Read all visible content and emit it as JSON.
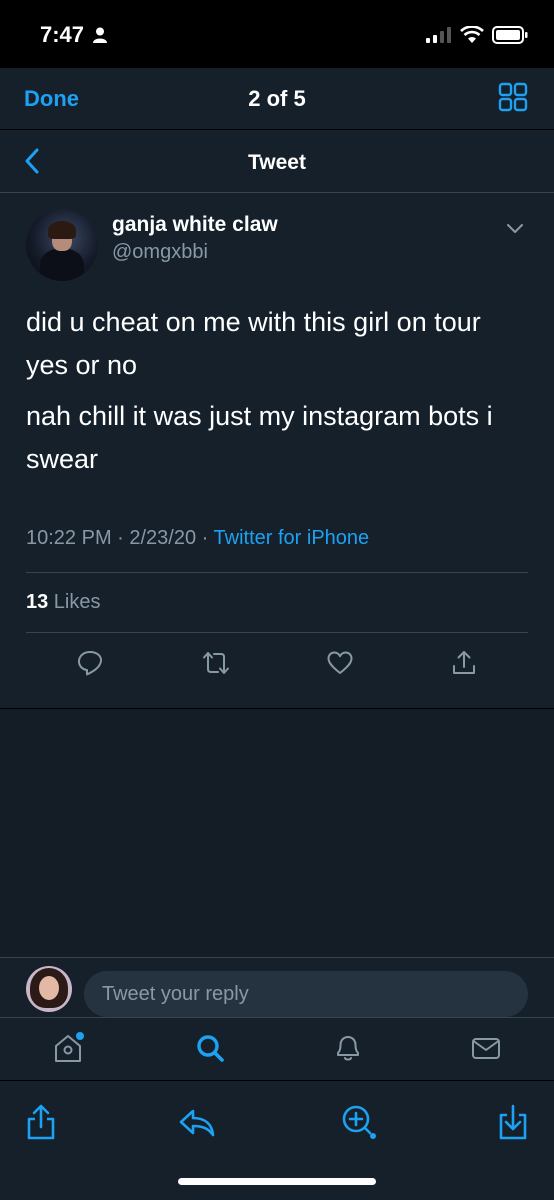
{
  "status_bar": {
    "time": "7:47"
  },
  "viewer": {
    "done_label": "Done",
    "position": "2 of 5"
  },
  "nav": {
    "title": "Tweet"
  },
  "tweet": {
    "display_name": "ganja white claw",
    "handle": "@omgxbbi",
    "text_line_1": "did u cheat on me with this girl on tour yes or no",
    "text_line_2": "nah chill it was just my instagram bots i swear",
    "time_date": "10:22 PM · 2/23/20 · ",
    "source": "Twitter for iPhone",
    "likes_count": "13",
    "likes_label": " Likes"
  },
  "reply": {
    "placeholder": "Tweet your reply"
  },
  "icons": {
    "status": [
      "person-icon",
      "signal-icon",
      "wifi-icon",
      "battery-icon"
    ],
    "viewer_top": [
      "grid-icon"
    ],
    "tweet_actions": [
      "reply-icon",
      "retweet-icon",
      "like-icon",
      "share-icon"
    ],
    "tabs": [
      "home-icon",
      "search-icon",
      "notifications-icon",
      "messages-icon"
    ],
    "viewer_bottom": [
      "share-icon",
      "reply-back-icon",
      "zoom-add-icon",
      "download-icon"
    ]
  },
  "colors": {
    "accent": "#1da1f2",
    "background": "#15202b",
    "muted": "#8899a6",
    "border": "#38444d"
  }
}
